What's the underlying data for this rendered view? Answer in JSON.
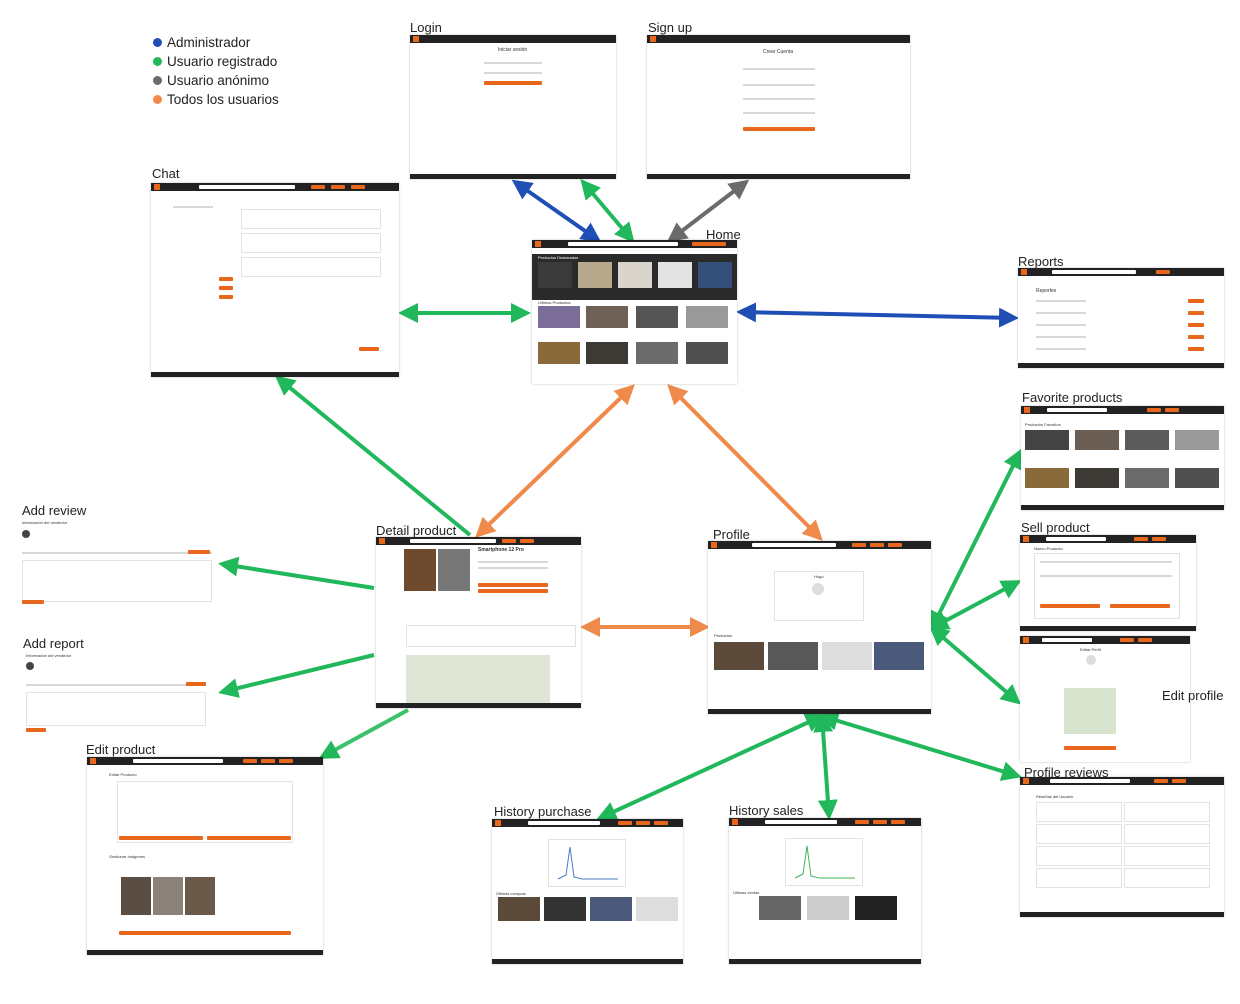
{
  "legend": [
    {
      "label": "Administrador",
      "color": "#1f4fb5"
    },
    {
      "label": "Usuario registrado",
      "color": "#20b85a"
    },
    {
      "label": "Usuario anónimo",
      "color": "#6b6b6b"
    },
    {
      "label": "Todos los usuarios",
      "color": "#f08a4b"
    }
  ],
  "colors": {
    "admin": "#1f4fb5",
    "registered": "#20b85a",
    "anonymous": "#6b6b6b",
    "all": "#f08a4b",
    "accent": "#e8671c",
    "nav": "#222222"
  },
  "screens": {
    "login": {
      "title": "Login",
      "heading": "Iniciar sesión"
    },
    "signup": {
      "title": "Sign up",
      "heading": "Crear Cuenta"
    },
    "chat": {
      "title": "Chat"
    },
    "home": {
      "title": "Home",
      "featured": "Productos Destacados",
      "latest": "Ultimos Productos"
    },
    "reports": {
      "title": "Reports",
      "heading": "Reportes"
    },
    "favorites": {
      "title": "Favorite products",
      "heading": "Productos Favoritos"
    },
    "sell": {
      "title": "Sell product",
      "heading": "Nuevo Producto"
    },
    "edit_profile": {
      "title": "Edit profile",
      "heading": "Editar Perfil"
    },
    "profile_reviews": {
      "title": "Profile reviews",
      "heading": "Reseñas del Usuario"
    },
    "add_review": {
      "title": "Add review",
      "heading": "Información del vendedor"
    },
    "add_report": {
      "title": "Add report",
      "heading": "Información del vendedor"
    },
    "detail": {
      "title": "Detail product",
      "product_name": "Smartphone 12 Pro"
    },
    "profile": {
      "title": "Profile",
      "user_name": "Hugo",
      "products": "Productos"
    },
    "edit_product": {
      "title": "Edit product",
      "heading": "Editar Producto",
      "images": "Gestionar Imágenes"
    },
    "history_purchase": {
      "title": "History purchase",
      "section": "Últimas compras"
    },
    "history_sales": {
      "title": "History sales",
      "section": "Últimas ventas"
    }
  },
  "edges": [
    {
      "from": "login",
      "to": "home",
      "role": "admin",
      "bidirectional": true
    },
    {
      "from": "login",
      "to": "home",
      "role": "registered",
      "bidirectional": true
    },
    {
      "from": "signup",
      "to": "home",
      "role": "anonymous",
      "bidirectional": true
    },
    {
      "from": "chat",
      "to": "home",
      "role": "registered",
      "bidirectional": true
    },
    {
      "from": "home",
      "to": "reports",
      "role": "admin",
      "bidirectional": true
    },
    {
      "from": "home",
      "to": "detail",
      "role": "all",
      "bidirectional": true
    },
    {
      "from": "home",
      "to": "profile",
      "role": "all",
      "bidirectional": true
    },
    {
      "from": "detail",
      "to": "chat",
      "role": "registered",
      "bidirectional": false
    },
    {
      "from": "detail",
      "to": "add_review",
      "role": "registered",
      "bidirectional": false
    },
    {
      "from": "detail",
      "to": "add_report",
      "role": "registered",
      "bidirectional": false
    },
    {
      "from": "detail",
      "to": "edit_product",
      "role": "registered",
      "bidirectional": false
    },
    {
      "from": "detail",
      "to": "profile",
      "role": "all",
      "bidirectional": true
    },
    {
      "from": "profile",
      "to": "favorites",
      "role": "registered",
      "bidirectional": true
    },
    {
      "from": "profile",
      "to": "sell",
      "role": "registered",
      "bidirectional": true
    },
    {
      "from": "profile",
      "to": "edit_profile",
      "role": "registered",
      "bidirectional": true
    },
    {
      "from": "profile",
      "to": "profile_reviews",
      "role": "registered",
      "bidirectional": true
    },
    {
      "from": "profile",
      "to": "history_purchase",
      "role": "registered",
      "bidirectional": true
    },
    {
      "from": "profile",
      "to": "history_sales",
      "role": "registered",
      "bidirectional": true
    }
  ]
}
